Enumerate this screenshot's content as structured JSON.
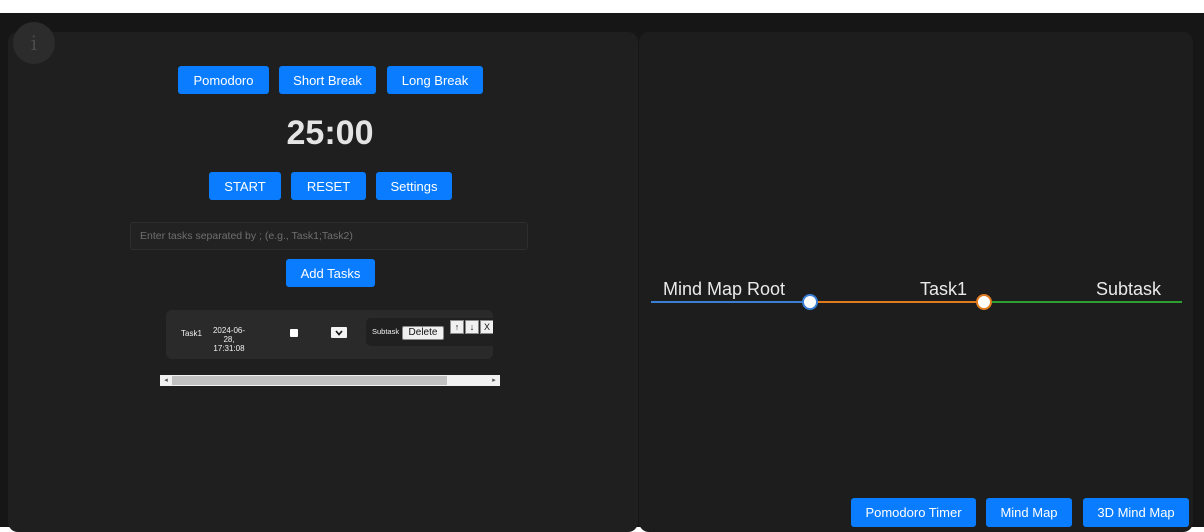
{
  "info_icon": {
    "glyph": "i",
    "icon": "info-icon"
  },
  "pomodoro": {
    "modes": [
      "Pomodoro",
      "Short Break",
      "Long Break"
    ],
    "timer": "25:00",
    "controls": {
      "start": "START",
      "reset": "RESET",
      "settings": "Settings"
    },
    "task_input": {
      "placeholder": "Enter tasks separated by ; (e.g., Task1;Task2)",
      "value": ""
    },
    "add_tasks": "Add Tasks"
  },
  "task_list": [
    {
      "name": "Task1",
      "date_line1": "2024-06-28,",
      "date_line2": "17:31:08",
      "completed": false,
      "subtask_label": "Subtask",
      "delete_label": "Delete",
      "move_up": "↑",
      "move_down": "↓",
      "remove": "X"
    }
  ],
  "scrollbar": {
    "left_arrow": "◂",
    "right_arrow": "▸",
    "position_fraction": 0.0
  },
  "mindmap": {
    "nodes": [
      {
        "label": "Mind Map Root",
        "color": "#3a7fd5"
      },
      {
        "label": "Task1",
        "color": "#e07b1f"
      },
      {
        "label": "Subtask",
        "color": "#2e9e2e"
      }
    ]
  },
  "bottom_nav": [
    "Pomodoro Timer",
    "Mind Map",
    "3D Mind Map"
  ],
  "colors": {
    "accent": "#0a7cff",
    "panel": "#1f1f1f",
    "background": "#161616"
  }
}
